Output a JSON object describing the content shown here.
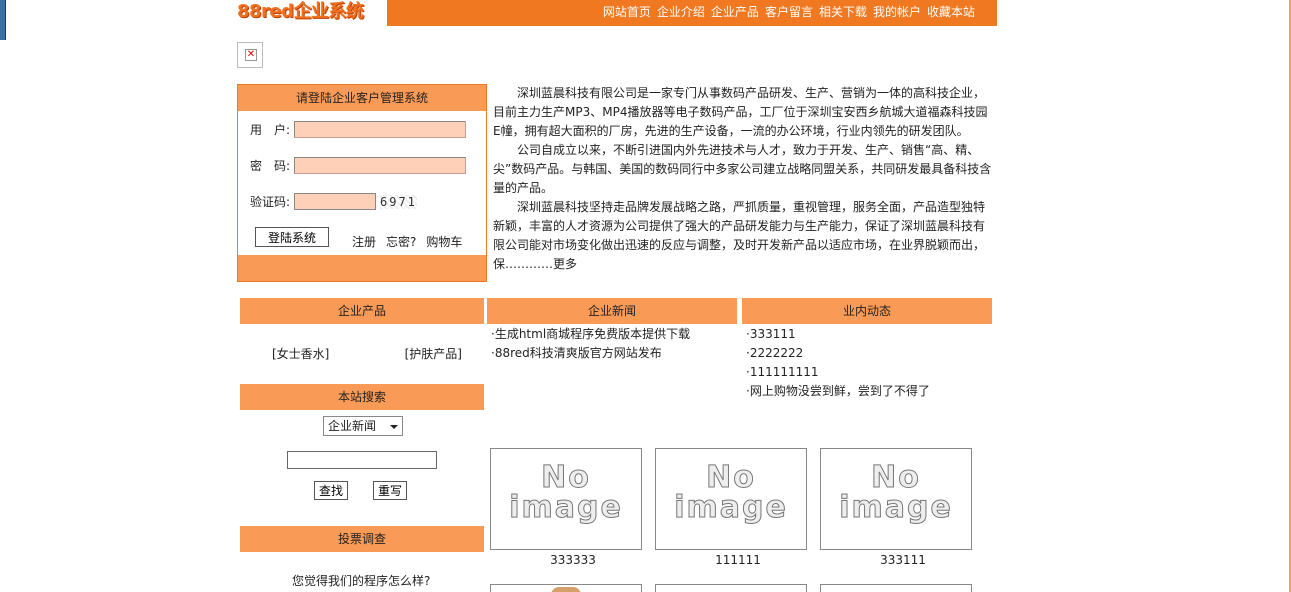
{
  "header": {
    "logo_text": "88red企业系统",
    "nav": [
      "网站首页",
      "企业介绍",
      "企业产品",
      "客户留言",
      "相关下载",
      "我的帐户",
      "收藏本站"
    ]
  },
  "login": {
    "title": "请登陆企业客户管理系统",
    "username_label": "用　户:",
    "password_label": "密　码:",
    "captcha_label": "验证码:",
    "captcha_code": "6971",
    "login_button": "登陆系统",
    "links": [
      "注册",
      "忘密?",
      "购物车"
    ]
  },
  "intro": {
    "paragraphs": [
      "深圳蓝晨科技有限公司是一家专门从事数码产品研发、生产、营销为一体的高科技企业，目前主力生产MP3、MP4播放器等电子数码产品，工厂位于深圳宝安西乡航城大道福森科技园E幢，拥有超大面积的厂房，先进的生产设备，一流的办公环境，行业内领先的研发团队。",
      "公司自成立以来，不断引进国内外先进技术与人才，致力于开发、生产、销售“高、精、尖”数码产品。与韩国、美国的数码同行中多家公司建立战略同盟关系，共同研发最具备科技含量的产品。",
      "深圳蓝晨科技坚持走品牌发展战略之路，严抓质量，重视管理，服务全面，产品造型独特新颖，丰富的人才资源为公司提供了强大的产品研发能力与生产能力，保证了深圳蓝晨科技有限公司能对市场变化做出迅速的反应与调整，及时开发新产品以适应市场，在业界脱颖而出，保…………"
    ],
    "more_link": "更多"
  },
  "products": {
    "header": "企业产品",
    "categories": [
      "[女士香水]",
      "[护肤产品]"
    ]
  },
  "news": {
    "header": "企业新闻",
    "items": [
      "·生成html商城程序免费版本提供下载",
      "·88red科技清爽版官方网站发布"
    ]
  },
  "industry": {
    "header": "业内动态",
    "items": [
      "·333111",
      "·2222222",
      "·111111111",
      "·网上购物没尝到鲜，尝到了不得了"
    ]
  },
  "search": {
    "header": "本站搜索",
    "select_value": "企业新闻",
    "search_button": "查找",
    "reset_button": "重写"
  },
  "vote": {
    "header": "投票调查",
    "question": "您觉得我们的程序怎么样?"
  },
  "thumbnails": [
    {
      "placeholder_top": "No",
      "placeholder_bottom": "image",
      "label": "333333"
    },
    {
      "placeholder_top": "No",
      "placeholder_bottom": "image",
      "label": "111111"
    },
    {
      "placeholder_top": "No",
      "placeholder_bottom": "image",
      "label": "333111"
    }
  ],
  "colors": {
    "accent": "#f07820",
    "header_bg": "#f99a56",
    "input_bg": "#ffd0b8"
  }
}
